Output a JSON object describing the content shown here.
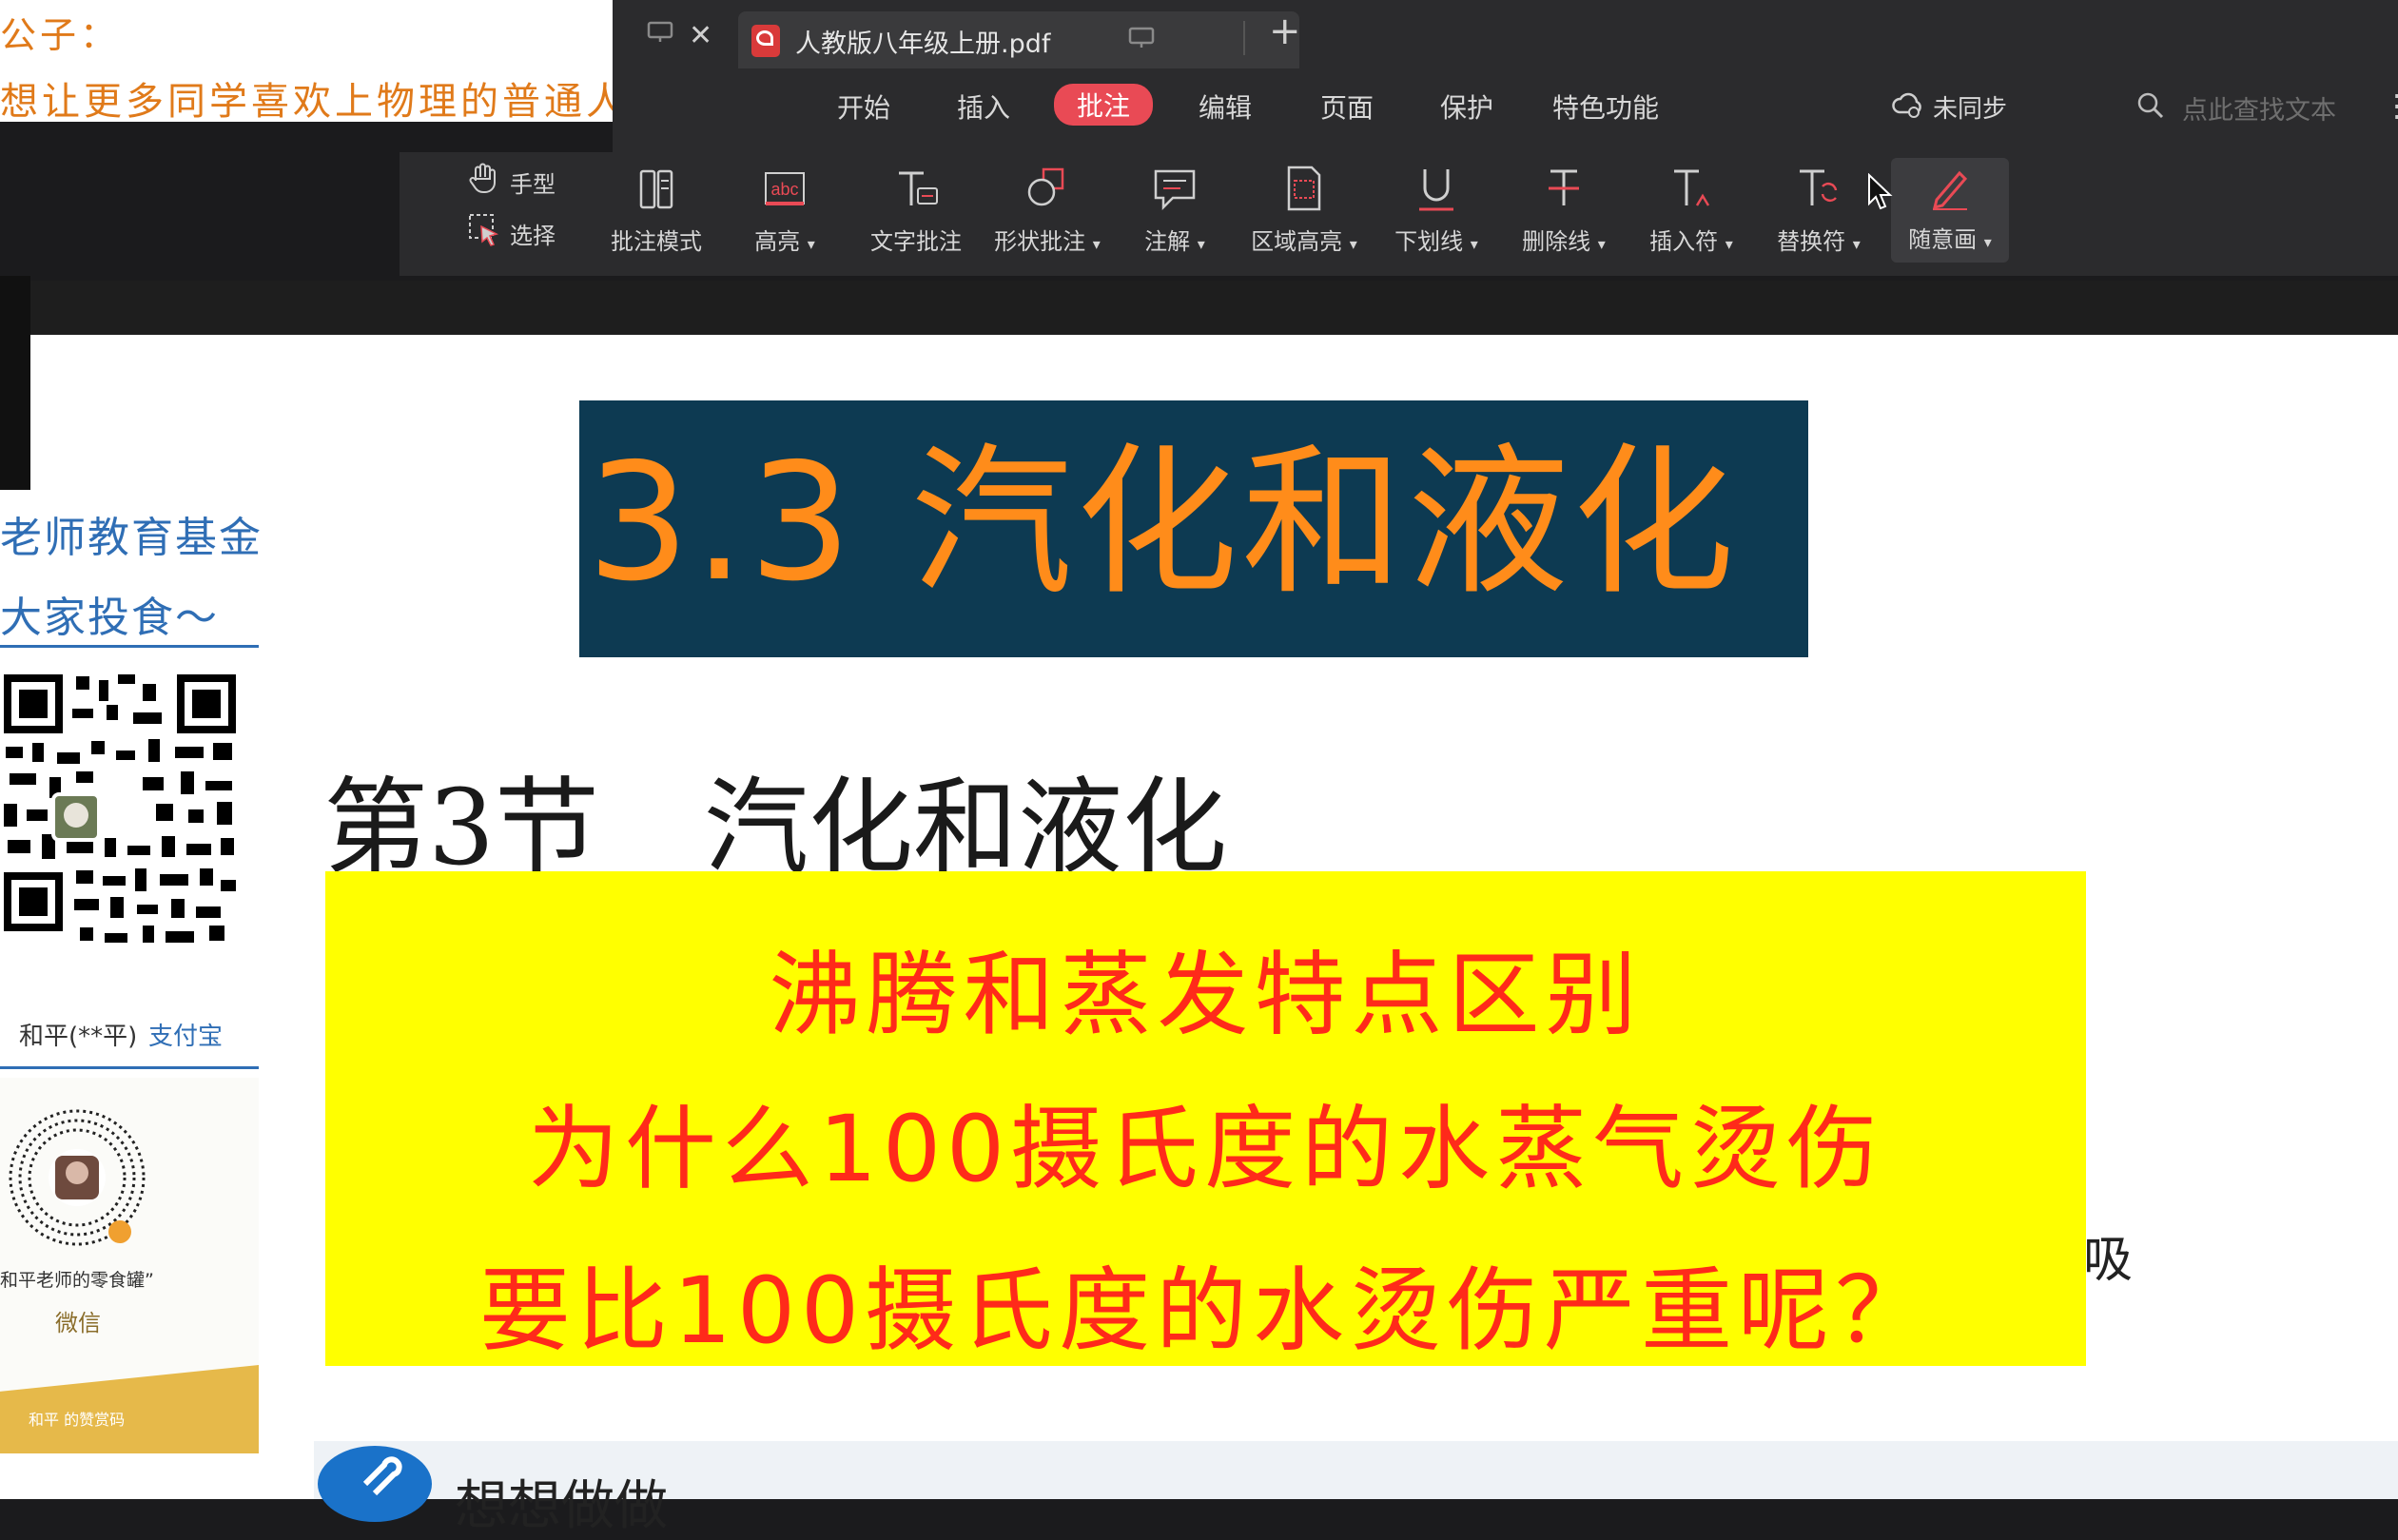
{
  "banner": {
    "line1": "公子：",
    "line2": "想让更多同学喜欢上物理的普通人！"
  },
  "tabbar": {
    "tab_title": "人教版八年级上册.pdf",
    "close_glyph": "✕",
    "new_tab_glyph": "+"
  },
  "menu": {
    "items": [
      "开始",
      "插入",
      "批注",
      "编辑",
      "页面",
      "保护",
      "特色功能"
    ],
    "active": "批注",
    "sync_label": "未同步",
    "search_placeholder": "点此查找文本",
    "more_glyph": "⋮"
  },
  "toolbar": {
    "hand_label": "手型",
    "select_label": "选择",
    "tools": [
      {
        "label": "批注模式",
        "icon": "annotation-mode-icon",
        "dropdown": false
      },
      {
        "label": "高亮",
        "icon": "highlight-abc-icon",
        "dropdown": true
      },
      {
        "label": "文字批注",
        "icon": "text-annotation-icon",
        "dropdown": false
      },
      {
        "label": "形状批注",
        "icon": "shape-annotation-icon",
        "dropdown": true
      },
      {
        "label": "注解",
        "icon": "note-icon",
        "dropdown": true
      },
      {
        "label": "区域高亮",
        "icon": "area-highlight-icon",
        "dropdown": true
      },
      {
        "label": "下划线",
        "icon": "underline-icon",
        "dropdown": true
      },
      {
        "label": "删除线",
        "icon": "strikethrough-icon",
        "dropdown": true
      },
      {
        "label": "插入符",
        "icon": "insert-caret-icon",
        "dropdown": true
      },
      {
        "label": "替换符",
        "icon": "replace-icon",
        "dropdown": true
      },
      {
        "label": "随意画",
        "icon": "freehand-pen-icon",
        "dropdown": true
      }
    ]
  },
  "sidebar": {
    "fund_line1": "老师教育基金",
    "fund_line2": "大家投食～",
    "alipay_name": "和平(**平)",
    "alipay_label": "支付宝",
    "wechat_caption": "和平老师的零食罐”",
    "wechat_label": "微信",
    "footer": "和平 的赞赏码"
  },
  "document": {
    "title": "3.3 汽化和液化",
    "heading": "第3节　汽化和液化",
    "yellow_lines": [
      "沸腾和蒸发特点区别",
      "为什么100摄氏度的水蒸气烫伤",
      "要比100摄氏度的水烫伤严重呢？"
    ],
    "edge_char": "吸",
    "bottom_section": "想想做做"
  },
  "colors": {
    "accent": "#e94a55",
    "title_bg": "#0d3a52",
    "title_text": "#ff8c1a",
    "yellow": "#ffff00",
    "red_text": "#ff2a1a",
    "banner_text": "#e07a1a",
    "side_blue": "#2f6eb5"
  }
}
